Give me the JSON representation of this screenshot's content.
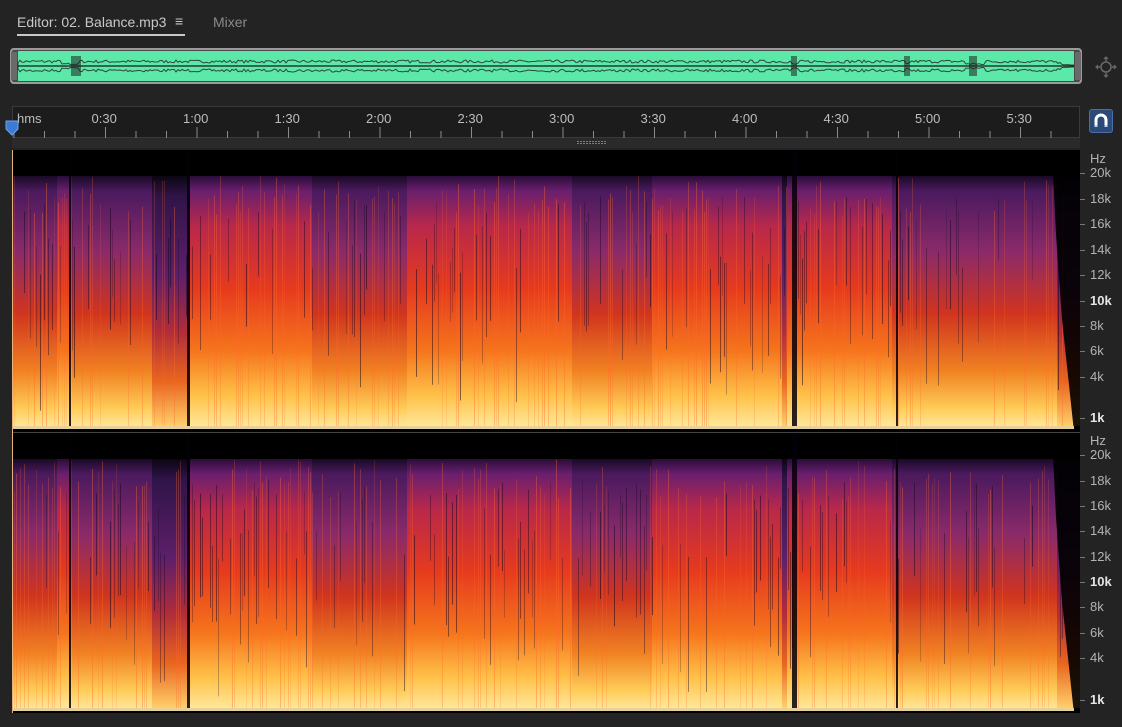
{
  "tabs": {
    "editor_label": "Editor: 02. Balance.mp3",
    "menu_glyph": "≡",
    "mixer_label": "Mixer"
  },
  "ruler": {
    "unit_label": "hms",
    "labels": [
      "0:30",
      "1:00",
      "1:30",
      "2:00",
      "2:30",
      "3:00",
      "3:30",
      "4:00",
      "4:30",
      "5:00",
      "5:30"
    ],
    "label_seconds": [
      30,
      60,
      90,
      120,
      150,
      180,
      210,
      240,
      270,
      300,
      330
    ],
    "duration_seconds": 350
  },
  "frequency_scale": {
    "unit_label": "Hz",
    "labels": [
      "20k",
      "18k",
      "16k",
      "14k",
      "12k",
      "10k",
      "8k",
      "6k",
      "4k",
      "1k"
    ],
    "bold_labels": [
      "10k",
      "1k"
    ]
  },
  "colors": {
    "waveform": "#5ce8a8",
    "accent_blue": "#3a7bd5",
    "spectrogram_low": "#ffd070",
    "spectrogram_mid": "#e03a20",
    "spectrogram_high": "#5a1e6a"
  },
  "icons": {
    "menu": "hamburger-menu-icon",
    "zoom": "zoom-navigator-icon",
    "snap": "magnet-snap-icon",
    "playhead": "playhead-marker-icon"
  }
}
